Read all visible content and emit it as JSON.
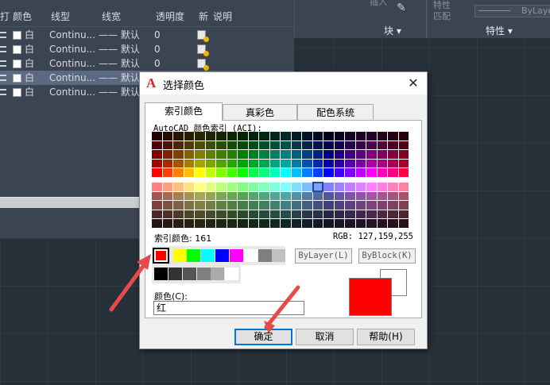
{
  "layer_panel": {
    "headers": {
      "print": "打",
      "color": "颜色",
      "linetype": "线型",
      "lineweight": "线宽",
      "transparency": "透明度",
      "new_vp": "新",
      "description": "说明"
    },
    "rows": [
      {
        "color": "白",
        "linetype": "Continu...",
        "lineweight": "—— 默认",
        "transparency": "0",
        "selected": false
      },
      {
        "color": "白",
        "linetype": "Continu...",
        "lineweight": "—— 默认",
        "transparency": "0",
        "selected": false
      },
      {
        "color": "白",
        "linetype": "Continu...",
        "lineweight": "—— 默认",
        "transparency": "0",
        "selected": false
      },
      {
        "color": "白",
        "linetype": "Continu...",
        "lineweight": "—— 默认",
        "transparency": "",
        "selected": true
      },
      {
        "color": "白",
        "linetype": "Continu...",
        "lineweight": "—— 默认",
        "transparency": "",
        "selected": false
      }
    ]
  },
  "ribbon": {
    "block_label": "块 ▾",
    "properties_label": "特性 ▾",
    "match_label_1": "特性",
    "match_label_2": "匹配",
    "insert_label": "插入",
    "bylayer_text": "ByLaye"
  },
  "dialog": {
    "title": "选择颜色",
    "close": "✕",
    "tabs": [
      "索引颜色",
      "真彩色",
      "配色系统"
    ],
    "aci_label": "AutoCAD 颜色索引 (ACI):",
    "index_color_label": "索引颜色: 161",
    "rgb_label": "RGB: 127,159,255",
    "bylayer_button": "ByLayer(L)",
    "byblock_button": "ByBlock(K)",
    "color_field_label": "颜色(C):",
    "color_value": "红",
    "ok_button": "确定",
    "cancel_button": "取消",
    "help_button": "帮助(H)",
    "preview_color": "#ff0000",
    "selected_standard": "红",
    "selected_aci_index": 161
  }
}
